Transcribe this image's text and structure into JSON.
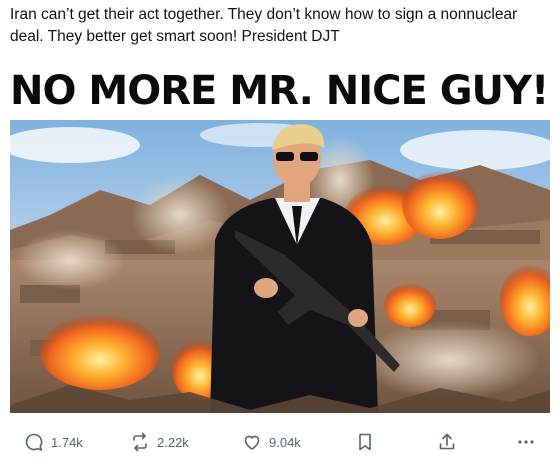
{
  "post": {
    "text": "Iran can’t get their act together. They don’t know how to sign a nonnuclear deal. They better get smart soon! President DJT"
  },
  "media": {
    "headline": "NO MORE MR. NICE GUY!",
    "flag_icon": "us-flag-icon"
  },
  "actions": {
    "replies": "1.74k",
    "reposts": "2.22k",
    "likes": "9.04k",
    "icons": [
      "reply-icon",
      "repost-icon",
      "like-icon",
      "bookmark-icon",
      "share-icon",
      "more-icon"
    ]
  },
  "colors": {
    "text": "#0f1419",
    "muted": "#536471",
    "sky": "#9cc1e4",
    "mountains": "#8a6a52",
    "fire": "#f0641e"
  }
}
